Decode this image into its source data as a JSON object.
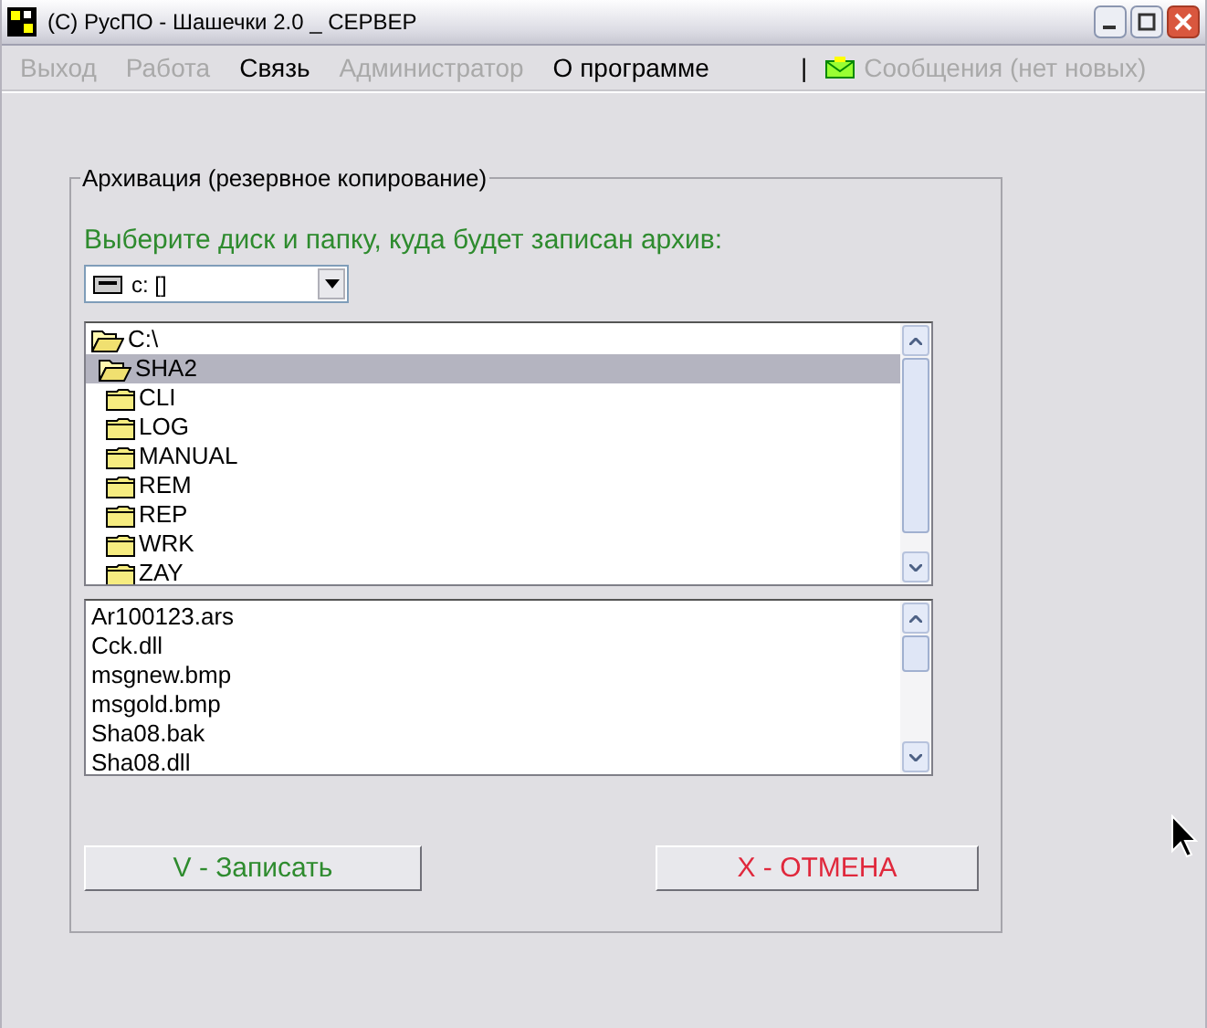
{
  "window": {
    "title": "(C) РусПО - Шашечки 2.0 _ СЕРВЕР"
  },
  "menu": [
    {
      "label": "Выход",
      "disabled": true
    },
    {
      "label": "Работа",
      "disabled": true
    },
    {
      "label": "Связь",
      "disabled": false
    },
    {
      "label": "Администратор",
      "disabled": true
    },
    {
      "label": "О программе",
      "disabled": false
    }
  ],
  "menu_separator": "|",
  "messages": {
    "label": "Сообщения (нет новых)",
    "disabled": true
  },
  "group": {
    "title": "Архивация (резервное копирование)",
    "prompt": "Выберите диск и папку, куда будет записан архив:",
    "drive": {
      "value": "c: []"
    },
    "folders": [
      {
        "name": "C:\\",
        "expanded": true,
        "selected": false,
        "children": [
          {
            "name": "SHA2",
            "expanded": true,
            "selected": true,
            "children": [
              {
                "name": "CLI",
                "expanded": false,
                "selected": false
              },
              {
                "name": "LOG",
                "expanded": false,
                "selected": false
              },
              {
                "name": "MANUAL",
                "expanded": false,
                "selected": false
              },
              {
                "name": "REM",
                "expanded": false,
                "selected": false
              },
              {
                "name": "REP",
                "expanded": false,
                "selected": false
              },
              {
                "name": "WRK",
                "expanded": false,
                "selected": false
              },
              {
                "name": "ZAY",
                "expanded": false,
                "selected": false
              }
            ]
          }
        ]
      }
    ],
    "files": [
      "Ar100123.ars",
      "Cck.dll",
      "msgnew.bmp",
      "msgold.bmp",
      "Sha08.bak",
      "Sha08.dll"
    ],
    "buttons": [
      {
        "label": "V - Записать",
        "kind": "ok"
      },
      {
        "label": "X - ОТМЕНА",
        "kind": "cancel"
      }
    ]
  }
}
